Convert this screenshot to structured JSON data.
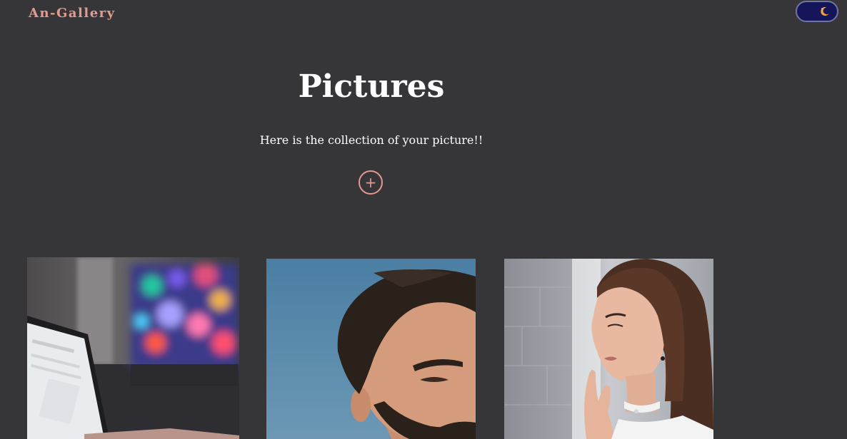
{
  "header": {
    "brand": "An-Gallery",
    "theme_toggle_icon": "moon-icon"
  },
  "hero": {
    "title": "Pictures",
    "subtitle": "Here is the collection of your picture!!",
    "add_label": "+"
  },
  "colors": {
    "background": "#363538",
    "accent": "#e39a8f",
    "toggle_bg": "#15165a"
  },
  "gallery": {
    "items": [
      {
        "subject": "laptop-photo"
      },
      {
        "subject": "man-portrait-photo"
      },
      {
        "subject": "woman-portrait-photo"
      }
    ]
  }
}
